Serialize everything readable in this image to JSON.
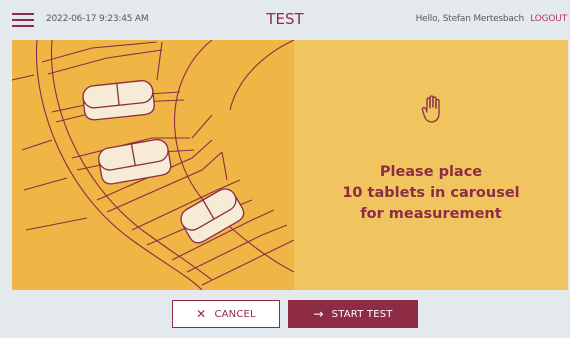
{
  "header": {
    "datetime": "2022-06-17  9:23:45 AM",
    "title": "TEST",
    "greeting": "Hello, Stefan Mertesbach",
    "logout_label": "LOGOUT"
  },
  "main": {
    "instruction": "Please place\n10 tablets in carousel\nfor measurement",
    "illustration_icon": "tablet-carousel-illustration",
    "instruction_icon": "hand-stop-icon"
  },
  "footer": {
    "cancel_icon": "✕",
    "cancel_label": "CANCEL",
    "start_icon": "→",
    "start_label": "START TEST"
  },
  "colors": {
    "accent": "#8e2c46",
    "panel": "#f0c45f",
    "illustration_bg": "#efb545",
    "chrome": "#e4e9ee"
  }
}
